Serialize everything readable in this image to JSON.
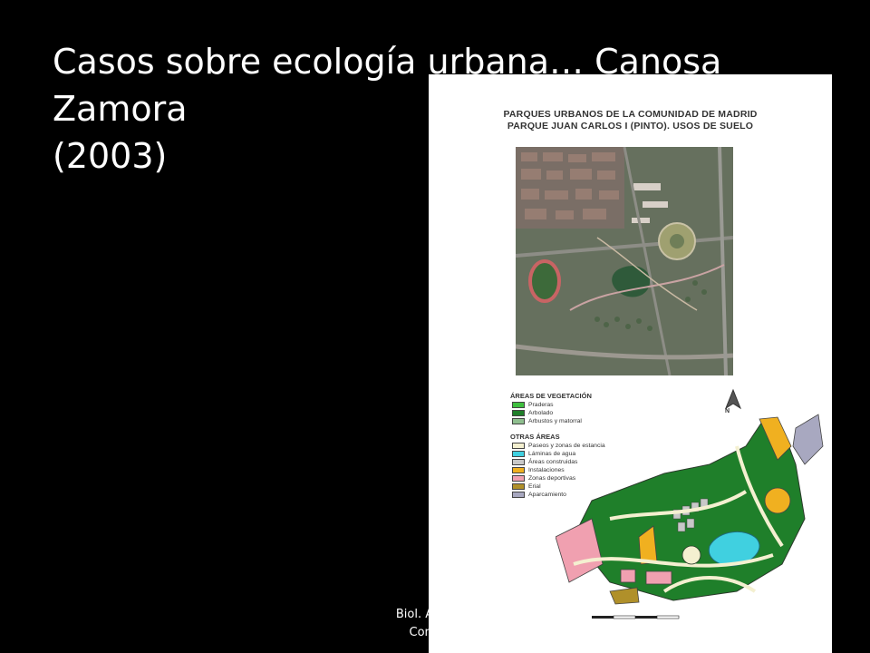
{
  "slide": {
    "title_line1": "Casos sobre ecología urbana… Canosa Zamora",
    "title_line2": "(2003)",
    "footer_line1": "Biol. Alejandr",
    "footer_line2": "Consulte"
  },
  "figure": {
    "heading_line1": "PARQUES URBANOS DE LA COMUNIDAD DE MADRID",
    "heading_line2": "PARQUE JUAN CARLOS I (PINTO). USOS DE SUELO",
    "north_label": "N",
    "legend": {
      "vegetation_title": "ÁREAS DE VEGETACIÓN",
      "vegetation": [
        {
          "label": "Praderas",
          "color": "#3fbf3f"
        },
        {
          "label": "Arbolado",
          "color": "#1f7f2a"
        },
        {
          "label": "Arbustos y matorral",
          "color": "#8fbf8f"
        }
      ],
      "other_title": "OTRAS ÁREAS",
      "other": [
        {
          "label": "Paseos y zonas de estancia",
          "color": "#f4f0d0"
        },
        {
          "label": "Láminas de agua",
          "color": "#40d0e0"
        },
        {
          "label": "Áreas construidas",
          "color": "#c8c8c8"
        },
        {
          "label": "Instalaciones",
          "color": "#f0b020"
        },
        {
          "label": "Zonas deportivas",
          "color": "#f0a0b0"
        },
        {
          "label": "Erial",
          "color": "#b0902a"
        },
        {
          "label": "Aparcamiento",
          "color": "#a8a8c0"
        }
      ]
    }
  }
}
